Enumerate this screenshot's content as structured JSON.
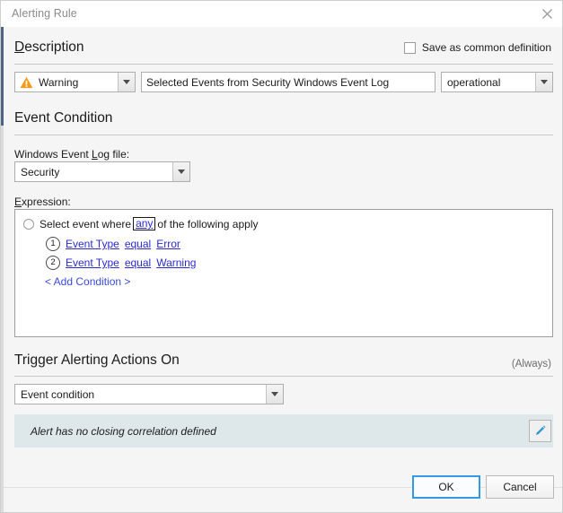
{
  "window": {
    "title": "Alerting Rule",
    "close_icon": "close-icon"
  },
  "description": {
    "heading_accel": "D",
    "heading_rest": "escription",
    "save_common_checkbox": {
      "label": "Save as common definition",
      "checked": false
    },
    "severity_combo": {
      "value": "Warning",
      "icon": "warning-triangle-icon"
    },
    "name_input": {
      "value": "Selected Events from Security Windows Event Log",
      "placeholder": ""
    },
    "category_combo": {
      "value": "operational"
    }
  },
  "event_condition": {
    "heading": "Event Condition",
    "log_file_label_pre": "Windows Event ",
    "log_file_label_accel": "L",
    "log_file_label_post": "og file:",
    "log_file_combo": {
      "value": "Security"
    },
    "expression_label_accel": "E",
    "expression_label_rest": "xpression:",
    "expression": {
      "prefix": "Select event where",
      "quantifier": "any",
      "suffix": "of the following apply",
      "conditions": [
        {
          "num": "1",
          "field": "Event Type",
          "operator": "equal",
          "value": "Error"
        },
        {
          "num": "2",
          "field": "Event Type",
          "operator": "equal",
          "value": "Warning"
        }
      ],
      "add_condition": "< Add Condition >"
    }
  },
  "trigger": {
    "heading": "Trigger Alerting Actions On",
    "always_note": "(Always)",
    "mode_combo": {
      "value": "Event condition"
    },
    "alert_banner": {
      "message": "Alert has no closing correlation defined",
      "edit_icon": "pencil-icon"
    }
  },
  "footer": {
    "ok_label": "OK",
    "cancel_label": "Cancel"
  },
  "colors": {
    "accent_blue": "#3399e6",
    "link_blue": "#2b2bd0",
    "warning_orange": "#f59b1c",
    "banner_bg": "#dee7e9",
    "pencil_blue": "#2e9bd6"
  }
}
